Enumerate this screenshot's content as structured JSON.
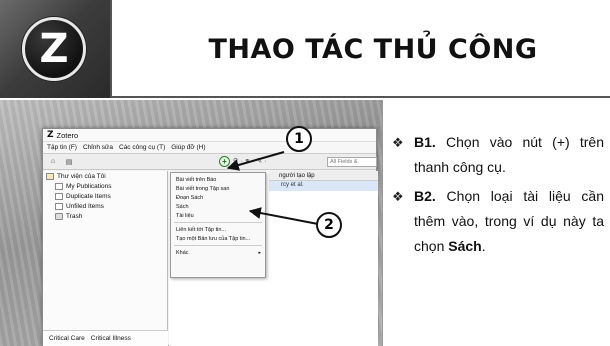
{
  "header": {
    "logo_letter": "Z",
    "title": "THAO TÁC THỦ CÔNG"
  },
  "app": {
    "window_title": "Zotero",
    "menu": [
      "Tập tin (F)",
      "Chỉnh sửa",
      "Các công cụ (T)",
      "Giúp đỡ (H)"
    ],
    "search_placeholder": "All Fields &",
    "column_header": "người tạo lập",
    "row_fragment": "rcy et al.",
    "library": {
      "root": "Thư viện của Tôi",
      "items": [
        "My Publications",
        "Duplicate Items",
        "Unfiled Items",
        "Trash"
      ]
    },
    "tags": [
      "Critical Care",
      "Critical Illness"
    ],
    "dropdown": {
      "group1": [
        "Bài viết trên Báo",
        "Bài viết trong Tập san",
        "Đoạn Sách",
        "Sách",
        "Tài liệu"
      ],
      "group2": [
        "Liên kết tới Tập tin...",
        "Tạo một Bản lưu của Tập tin..."
      ],
      "more": "Khác"
    }
  },
  "callouts": {
    "one": "1",
    "two": "2"
  },
  "steps": [
    {
      "label": "B1.",
      "text": " Chọn vào nút (+) trên thanh công cụ."
    },
    {
      "label": "B2.",
      "text_before": " Chọn loại tài liệu cần thêm vào, trong ví dụ này ta chọn ",
      "emphasis": "Sách",
      "text_after": "."
    }
  ],
  "colors": {
    "border": "#555555",
    "logo_bg": "#3d3d3d",
    "new_button": "#2d7d2d"
  }
}
